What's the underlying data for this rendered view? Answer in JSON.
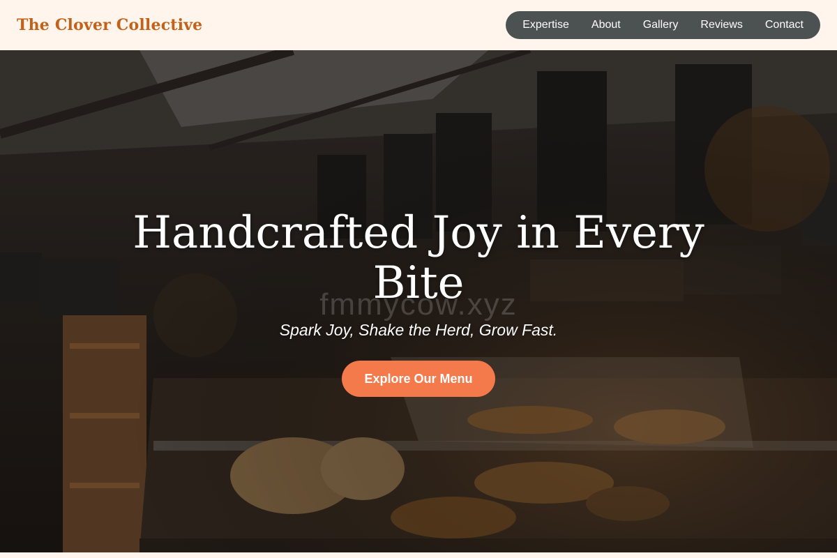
{
  "brand": {
    "name": "The Clover Collective",
    "color": "#c2611a"
  },
  "nav": {
    "items": [
      {
        "label": "Expertise"
      },
      {
        "label": "About"
      },
      {
        "label": "Gallery"
      },
      {
        "label": "Reviews"
      },
      {
        "label": "Contact"
      }
    ]
  },
  "hero": {
    "title": "Handcrafted Joy in Every Bite",
    "watermark": "fmmycow.xyz",
    "subtitle": "Spark Joy, Shake the Herd, Grow Fast.",
    "cta_label": "Explore Our Menu",
    "cta_color": "#f47a4c",
    "background_image": "bakery-cafe-counter-photo"
  }
}
